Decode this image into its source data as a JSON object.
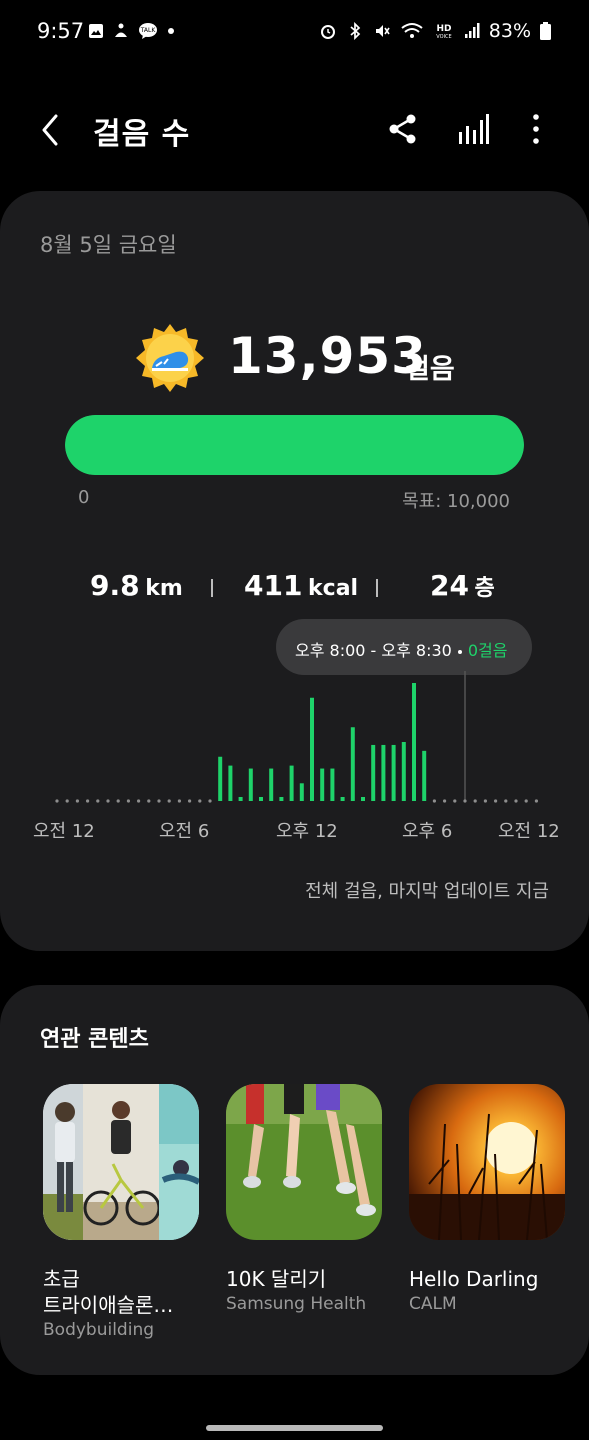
{
  "status_bar": {
    "time": "9:57",
    "battery": "83%",
    "icons": [
      "gallery-icon",
      "accessibility-icon",
      "talk-icon",
      "dot-icon",
      "alarm-icon",
      "bluetooth-icon",
      "mute-icon",
      "wifi-icon",
      "hd-voice-icon",
      "signal-icon",
      "battery-icon"
    ]
  },
  "app_bar": {
    "title": "걸음 수",
    "icons": [
      "back-icon",
      "share-icon",
      "bar-chart-icon",
      "more-vert-icon"
    ]
  },
  "summary": {
    "date": "8월 5일 금요일",
    "steps": "13,953",
    "steps_unit": "걸음",
    "progress_fraction": 1.0,
    "progress_color": "#1ed36a",
    "progress_min": "0",
    "progress_goal": "목표: 10,000",
    "distance_value": "9.8",
    "distance_unit": "km",
    "calories_value": "411",
    "calories_unit": "kcal",
    "floors_value": "24",
    "floors_unit": "층"
  },
  "tooltip": {
    "time_range": "오후 8:00 - 오후 8:30",
    "steps": "0걸음"
  },
  "chart_data": {
    "type": "bar",
    "x_labels": [
      "오전 12",
      "오전 6",
      "오후 12",
      "오후 6",
      "오전 12"
    ],
    "values": [
      0,
      0,
      0,
      0,
      0,
      0,
      0,
      0,
      0,
      0,
      0,
      0,
      0,
      0,
      0,
      0,
      15,
      12,
      1,
      11,
      1,
      11,
      1,
      12,
      6,
      35,
      11,
      11,
      1,
      25,
      1,
      19,
      19,
      19,
      20,
      40,
      17,
      0,
      0,
      0,
      0,
      0,
      0,
      0,
      0,
      0,
      0,
      0
    ],
    "ylim": [
      0,
      40
    ],
    "bar_color": "#1ed36a",
    "selected_index": 40,
    "footnote": "전체 걸음, 마지막 업데이트 지금"
  },
  "related": {
    "title": "연관 콘텐츠",
    "items": [
      {
        "title": "초급\n트라이애슬론…",
        "subtitle": "Bodybuilding"
      },
      {
        "title": "10K 달리기",
        "subtitle": "Samsung Health"
      },
      {
        "title": "Hello Darling",
        "subtitle": "CALM"
      }
    ]
  }
}
